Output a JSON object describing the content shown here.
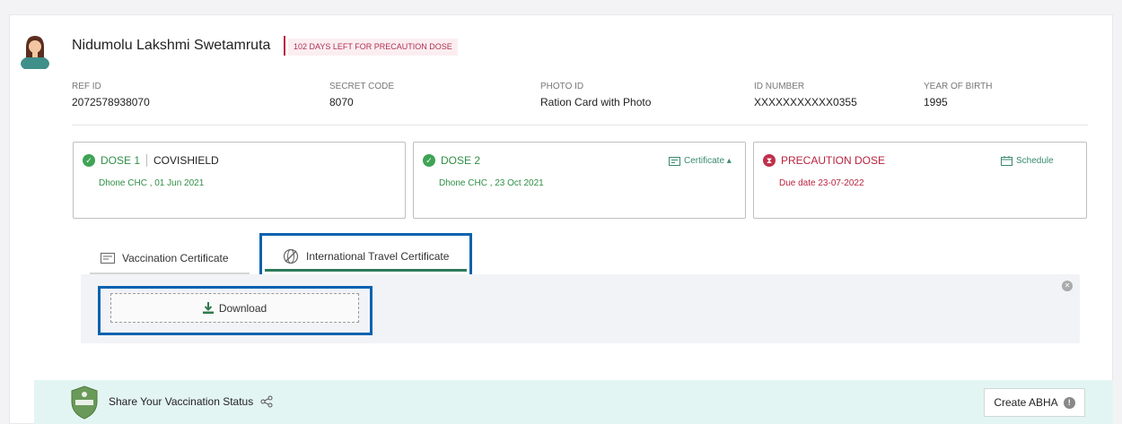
{
  "person": {
    "name": "Nidumolu Lakshmi Swetamruta",
    "badge": "102 DAYS LEFT FOR PRECAUTION DOSE"
  },
  "info": [
    {
      "label": "REF ID",
      "value": "2072578938070"
    },
    {
      "label": "SECRET CODE",
      "value": "8070"
    },
    {
      "label": "PHOTO ID",
      "value": "Ration Card with Photo"
    },
    {
      "label": "ID NUMBER",
      "value": "XXXXXXXXXXX0355"
    },
    {
      "label": "YEAR OF BIRTH",
      "value": "1995"
    }
  ],
  "doses": {
    "dose1": {
      "title": "DOSE 1",
      "vaccine": "COVISHIELD",
      "detail": "Dhone CHC , 01 Jun 2021"
    },
    "dose2": {
      "title": "DOSE 2",
      "detail": "Dhone CHC , 23 Oct 2021",
      "link": "Certificate ▴"
    },
    "precaution": {
      "title": "PRECAUTION DOSE",
      "detail": "Due date 23-07-2022",
      "link": "Schedule"
    }
  },
  "tabs": {
    "vaccination": "Vaccination Certificate",
    "travel": "International Travel Certificate"
  },
  "download": {
    "label": "Download"
  },
  "footer": {
    "share": "Share Your Vaccination Status",
    "abha": "Create ABHA"
  },
  "colors": {
    "accent_green": "#2f8f45",
    "alert_red": "#b8233f",
    "highlight_blue": "#0a62ae",
    "footer_bg": "#e3f5f2"
  }
}
